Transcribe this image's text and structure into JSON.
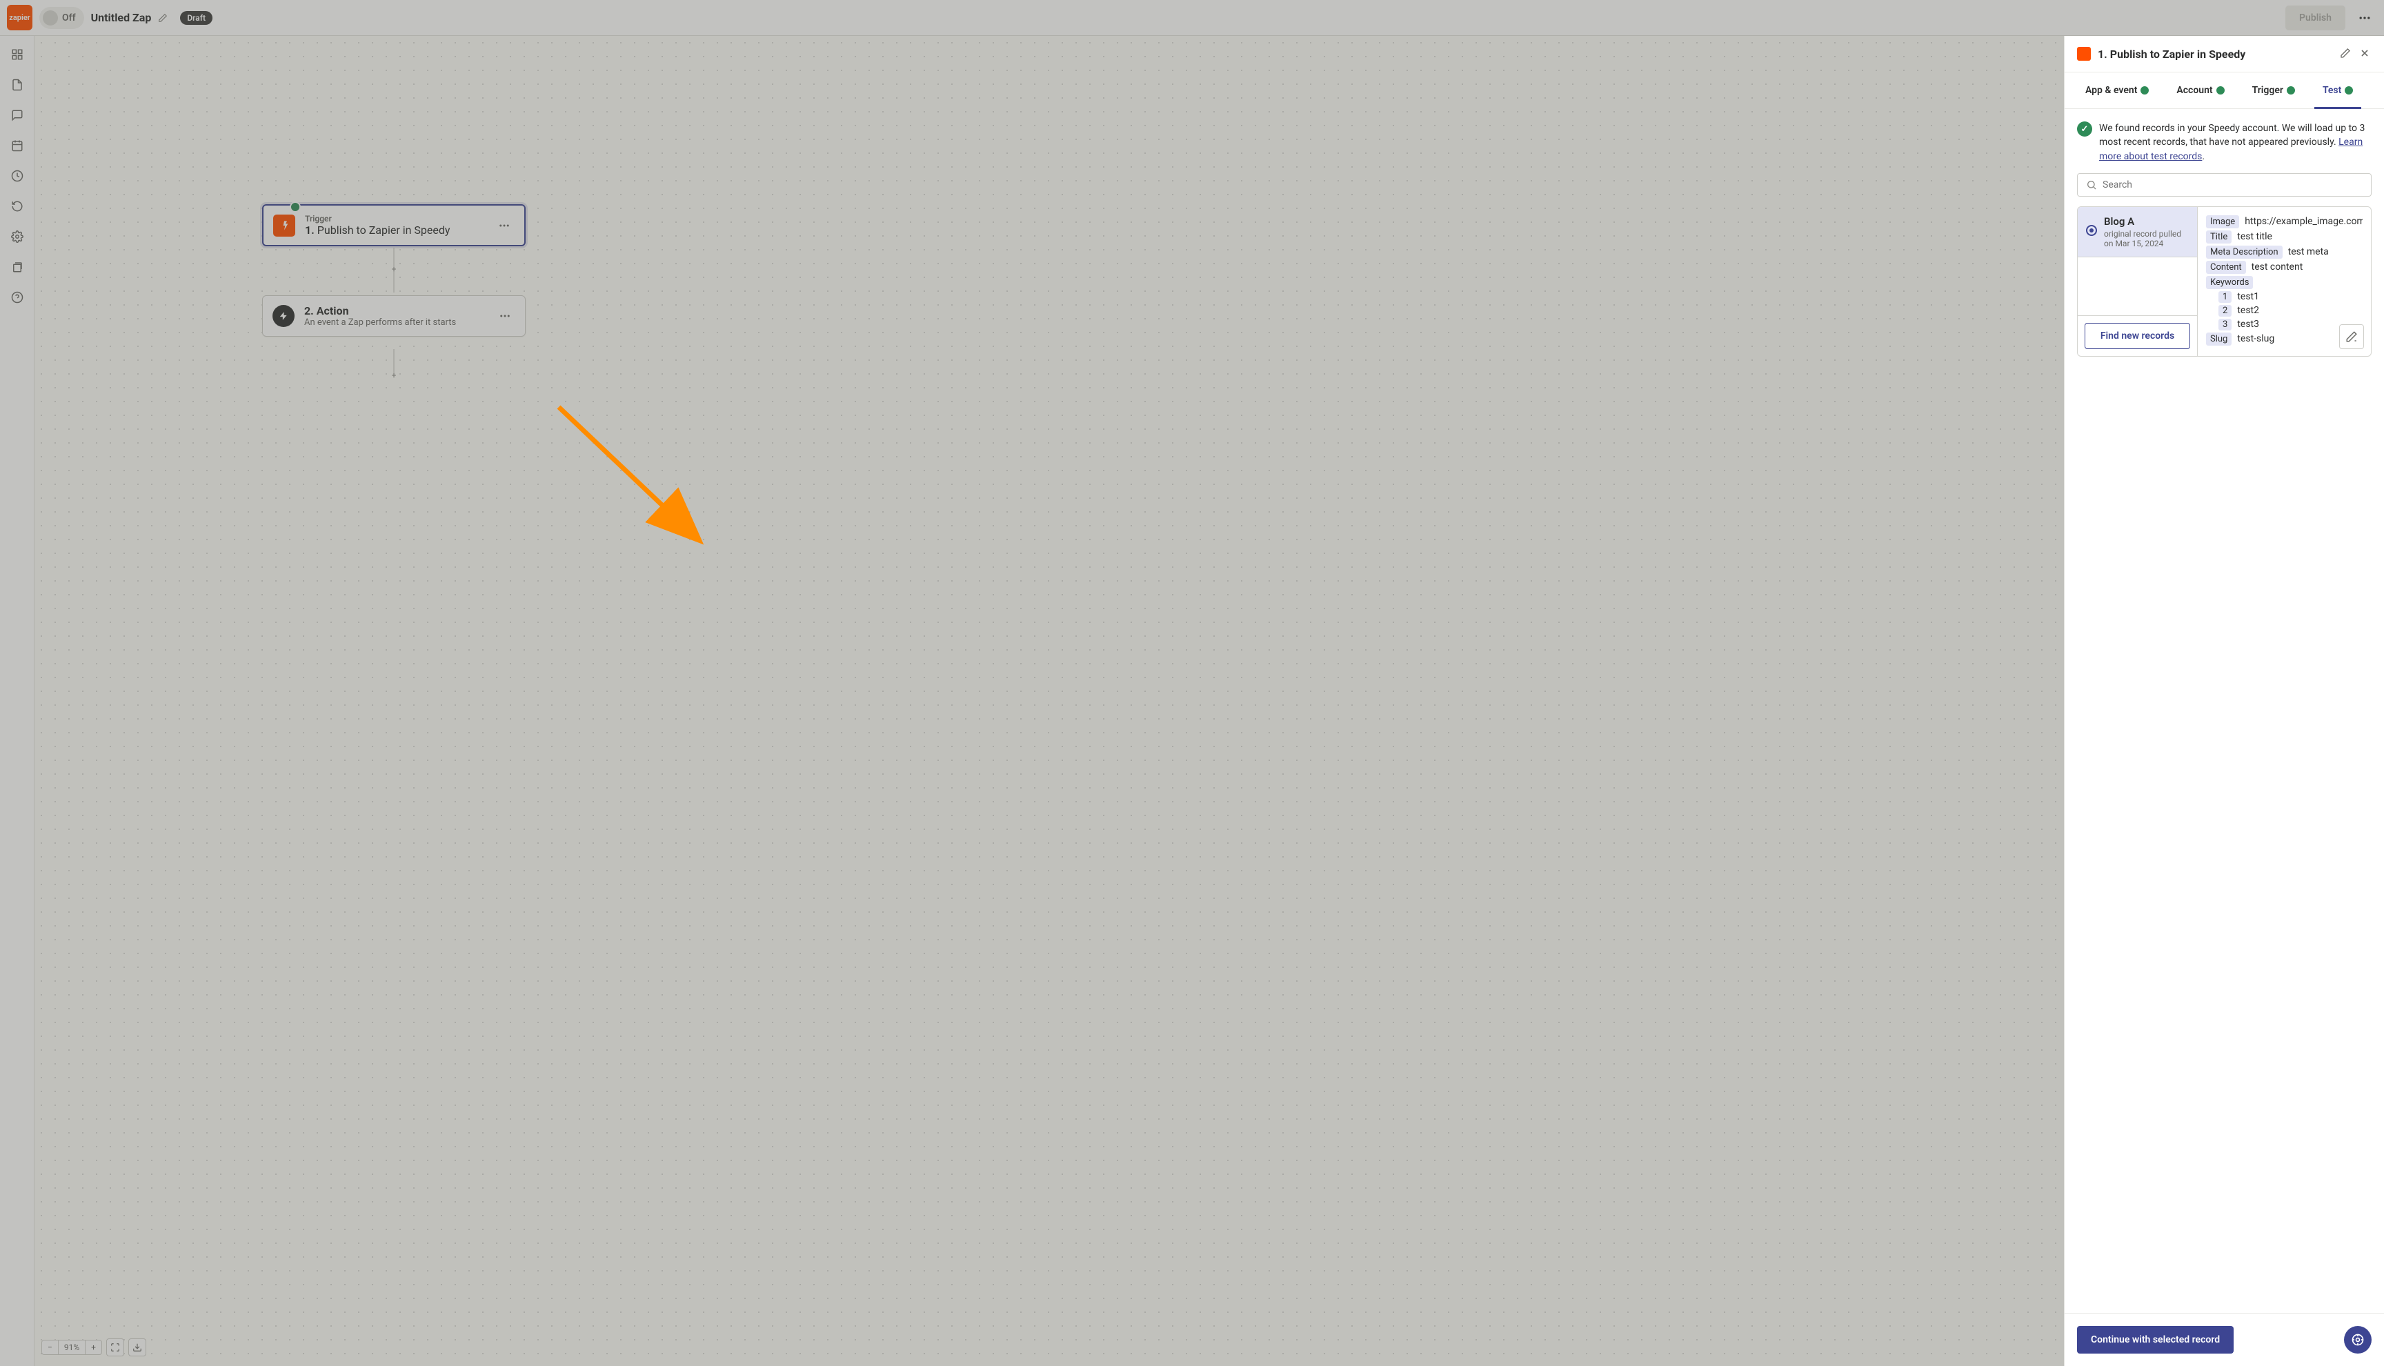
{
  "colors": {
    "accent": "#3d4592",
    "brand": "#ff4f00",
    "success": "#2e8b57"
  },
  "topbar": {
    "logo_text": "zapier",
    "toggle_state": "Off",
    "zap_title": "Untitled Zap",
    "draft_label": "Draft",
    "publish_label": "Publish"
  },
  "canvas": {
    "zoom_level": "91%",
    "nodes": {
      "trigger": {
        "eyebrow": "Trigger",
        "number": "1.",
        "title": "Publish to Zapier in Speedy"
      },
      "action": {
        "number": "2.",
        "title": "Action",
        "subtitle": "An event a Zap performs after it starts"
      }
    }
  },
  "panel": {
    "header_title": "1. Publish to Zapier in Speedy",
    "tabs": {
      "app_event": "App & event",
      "account": "Account",
      "trigger": "Trigger",
      "test": "Test"
    },
    "info_text_1": "We found records in your Speedy account. We will load up to 3 most recent records, that have not appeared previously. ",
    "info_link": "Learn more about test records",
    "info_text_2": ".",
    "search_placeholder": "Search",
    "record": {
      "name": "Blog A",
      "meta": "original record pulled on Mar 15, 2024",
      "fields": {
        "image": {
          "key": "Image",
          "val": "https://example_image.com/i"
        },
        "title": {
          "key": "Title",
          "val": "test title"
        },
        "meta_desc": {
          "key": "Meta Description",
          "val": "test meta"
        },
        "content": {
          "key": "Content",
          "val": "test content"
        },
        "keywords_label": "Keywords",
        "keywords": [
          {
            "idx": "1",
            "val": "test1"
          },
          {
            "idx": "2",
            "val": "test2"
          },
          {
            "idx": "3",
            "val": "test3"
          }
        ],
        "slug": {
          "key": "Slug",
          "val": "test-slug"
        }
      }
    },
    "find_new_label": "Find new records",
    "continue_label": "Continue with selected record"
  }
}
